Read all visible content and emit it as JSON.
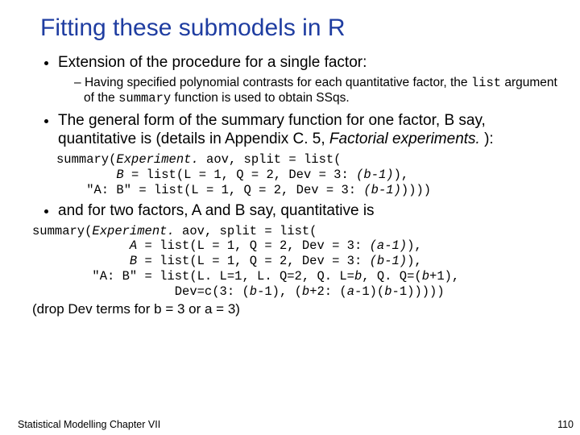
{
  "title": "Fitting these submodels in R",
  "bullet1": "Extension of the procedure for a single factor:",
  "sub1_pre": "Having specified polynomial contrasts for each quantitative factor, the ",
  "sub1_code1": "list",
  "sub1_mid": " argument of the ",
  "sub1_code2": "summary",
  "sub1_post": " function is used to obtain SSqs.",
  "bullet2_pre": "The general form of the summary function for one factor, B say, quantitative is (details in Appendix C. 5, ",
  "bullet2_ital": "Factorial experiments.",
  "bullet2_post": " ):",
  "code1_l1a": "summary(",
  "code1_l1b": "Experiment.",
  "code1_l1c": " aov, split = list(",
  "code1_l2a": "        ",
  "code1_l2b": "B",
  "code1_l2c": " = list(L = 1, Q = 2, Dev = 3: ",
  "code1_l2d": "(b-1)",
  "code1_l2e": "),",
  "code1_l3a": "    \"A: B\" = list(L = 1, Q = 2, Dev = 3: ",
  "code1_l3b": "(b-1)",
  "code1_l3c": "))))",
  "bullet3": "and for two factors, A and B say, quantitative is",
  "code2_l1a": "summary(",
  "code2_l1b": "Experiment.",
  "code2_l1c": " aov, split = list(",
  "code2_l2a": "             ",
  "code2_l2b": "A",
  "code2_l2c": " = list(L = 1, Q = 2, Dev = 3: ",
  "code2_l2d": "(a-1)",
  "code2_l2e": "),",
  "code2_l3a": "             ",
  "code2_l3b": "B",
  "code2_l3c": " = list(L = 1, Q = 2, Dev = 3: ",
  "code2_l3d": "(b-1)",
  "code2_l3e": "),",
  "code2_l4a": "        \"A: B\" = list(L. L=1, L. Q=2, Q. L=",
  "code2_l4b": "b",
  "code2_l4c": ", Q. Q=(",
  "code2_l4d": "b",
  "code2_l4e": "+1),",
  "code2_l5a": "                   Dev=c(3: (",
  "code2_l5b": "b",
  "code2_l5c": "-1), (",
  "code2_l5d": "b",
  "code2_l5e": "+2: (",
  "code2_l5f": "a",
  "code2_l5g": "-1)(",
  "code2_l5h": "b",
  "code2_l5i": "-1)))))",
  "drop": "(drop Dev terms for b = 3 or a = 3)",
  "footer_left": "Statistical Modelling   Chapter VII",
  "footer_right": "110"
}
